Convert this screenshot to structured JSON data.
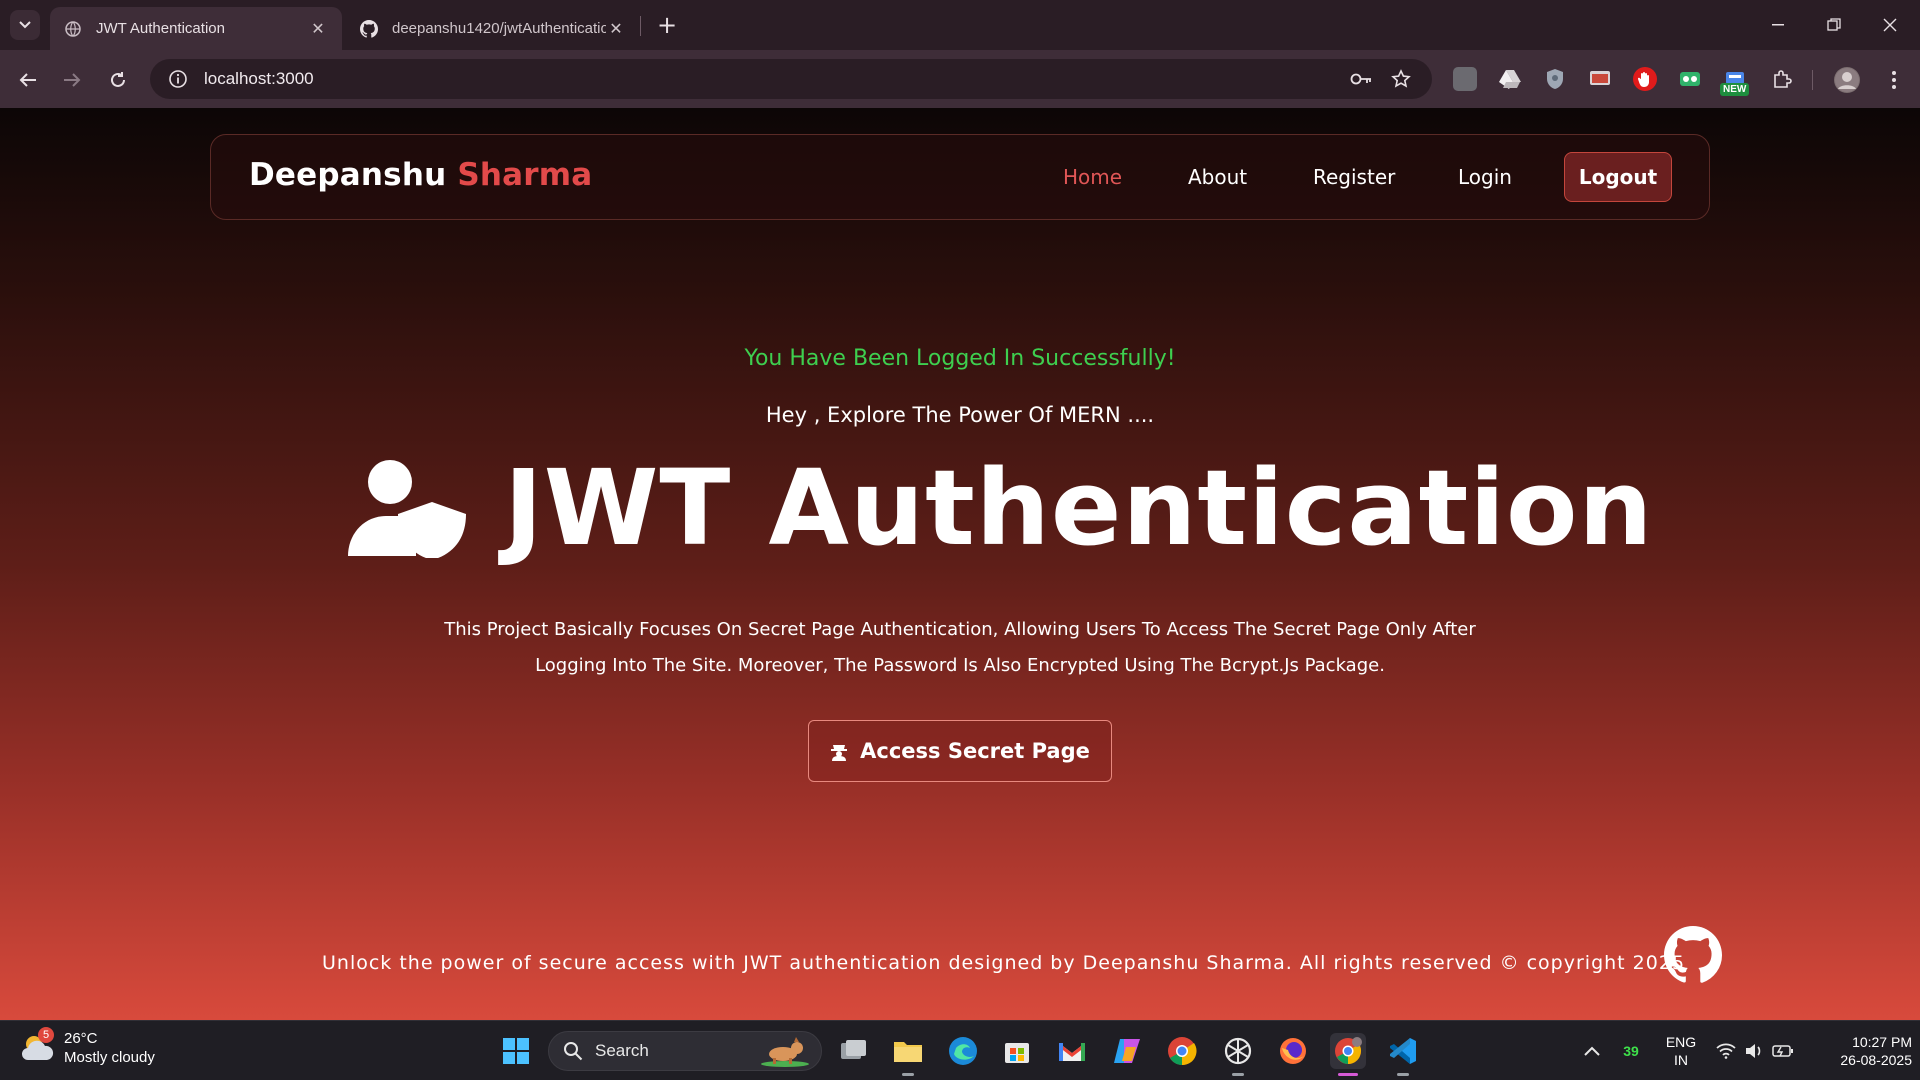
{
  "browser": {
    "tabs": [
      {
        "title": "JWT Authentication",
        "active": true,
        "favicon": "globe-icon"
      },
      {
        "title": "deepanshu1420/jwtAuthentication",
        "active": false,
        "favicon": "github-icon"
      }
    ],
    "url": "localhost:3000",
    "extensions": [
      "folder-icon",
      "drive-icon",
      "shield-icon",
      "screencast-icon",
      "hand-icon",
      "grammar-icon",
      "new-ext-icon",
      "puzzle-icon"
    ],
    "new_badge": "NEW"
  },
  "page": {
    "brand": {
      "first": "Deepanshu",
      "second": "Sharma"
    },
    "nav": {
      "home": "Home",
      "about": "About",
      "register": "Register",
      "login": "Login",
      "logout": "Logout"
    },
    "success_message": "You Have Been Logged In Successfully!",
    "subtitle": "Hey , Explore The Power Of MERN ....",
    "hero_title": "JWT Authentication",
    "description_line1": "This Project Basically Focuses On Secret Page Authentication, Allowing Users To Access The Secret Page Only After",
    "description_line2": "Logging Into The Site. Moreover, The Password Is Also Encrypted Using The Bcrypt.Js Package.",
    "secret_button": "Access Secret Page",
    "footer": "Unlock the power of secure access with JWT authentication designed by Deepanshu Sharma. All rights reserved © copyright 2025"
  },
  "colors": {
    "accent_red": "#e24a4a",
    "success_green": "#3ecf4f",
    "active_nav": "#e05656"
  },
  "taskbar": {
    "weather_temp": "26°C",
    "weather_cond": "Mostly cloudy",
    "weather_badge": "5",
    "search_label": "Search",
    "tray_count": "39",
    "lang_top": "ENG",
    "lang_bottom": "IN",
    "time": "10:27 PM",
    "date": "26-08-2025"
  }
}
